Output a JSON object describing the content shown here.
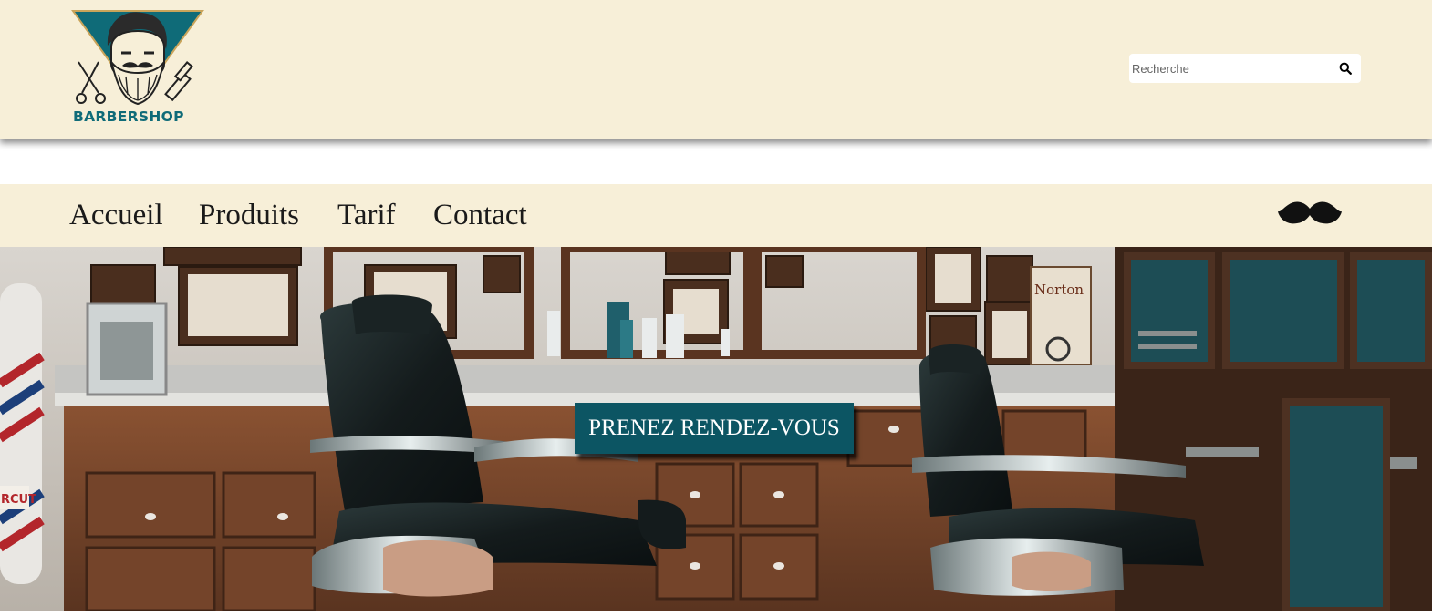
{
  "brand": {
    "logo_text": "BARBERSHOP",
    "color": "#0f6b78"
  },
  "search": {
    "placeholder": "Recherche",
    "icon": "search-icon"
  },
  "nav": {
    "items": [
      {
        "label": "Accueil"
      },
      {
        "label": "Produits"
      },
      {
        "label": "Tarif"
      },
      {
        "label": "Contact"
      }
    ],
    "decoration_icon": "mustache-icon"
  },
  "hero": {
    "cta_label": "PRENEZ RENDEZ-VOUS",
    "poster_text": "Norton",
    "pole_text": "RCUT"
  },
  "colors": {
    "header_bg": "#f7efd8",
    "cta_bg": "#0c5563",
    "brand_teal": "#0f6b78"
  }
}
